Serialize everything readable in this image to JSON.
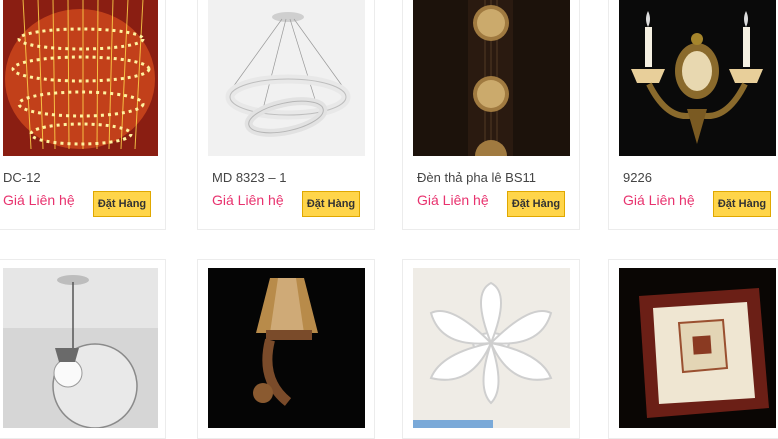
{
  "products": [
    {
      "name": "DC-12",
      "price": "Giá Liên hệ",
      "order_label": "Đặt Hàng",
      "image": "fiber-optic-chandelier"
    },
    {
      "name": "MD 8323 – 1",
      "price": "Giá Liên hệ",
      "order_label": "Đặt Hàng",
      "image": "ring-pendant-light"
    },
    {
      "name": "Đèn thả pha lê BS11",
      "price": "Giá Liên hệ",
      "order_label": "Đặt Hàng",
      "image": "crystal-ball-pendant"
    },
    {
      "name": "9226",
      "price": "Giá Liên hệ",
      "order_label": "Đặt Hàng",
      "image": "brass-wall-sconce"
    },
    {
      "image": "glass-globe-pendant"
    },
    {
      "image": "bronze-wall-lamp"
    },
    {
      "image": "flower-ceiling-light"
    },
    {
      "image": "square-wooden-ceiling-light"
    }
  ]
}
